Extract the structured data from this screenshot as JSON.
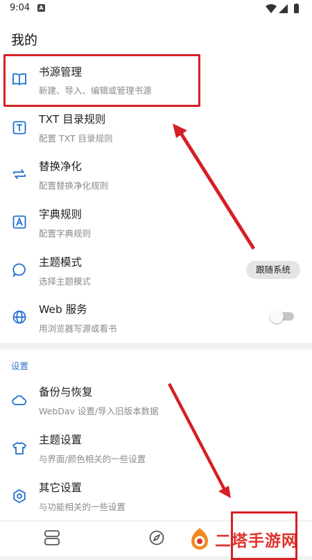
{
  "status_bar": {
    "time": "9:04",
    "notification": "A"
  },
  "page": {
    "title": "我的"
  },
  "items": [
    {
      "icon": "book-open-icon",
      "title": "书源管理",
      "subtitle": "新建、导入、编辑或管理书源"
    },
    {
      "icon": "txt-box-icon",
      "title": "TXT 目录规则",
      "subtitle": "配置 TXT 目录规则"
    },
    {
      "icon": "swap-arrows-icon",
      "title": "替换净化",
      "subtitle": "配置替换净化规则"
    },
    {
      "icon": "dictionary-box-icon",
      "title": "字典规则",
      "subtitle": "配置字典规则"
    },
    {
      "icon": "speech-bubble-icon",
      "title": "主题模式",
      "subtitle": "选择主题模式",
      "value": "跟随系统"
    },
    {
      "icon": "globe-icon",
      "title": "Web 服务",
      "subtitle": "用浏览器写源或看书",
      "toggle": false
    }
  ],
  "settings": {
    "header": "设置",
    "items": [
      {
        "icon": "cloud-icon",
        "title": "备份与恢复",
        "subtitle": "WebDav 设置/导入旧版本数据"
      },
      {
        "icon": "tshirt-icon",
        "title": "主题设置",
        "subtitle": "与界面/颜色相关的一些设置"
      },
      {
        "icon": "hexagon-settings-icon",
        "title": "其它设置",
        "subtitle": "与功能相关的一些设置"
      }
    ]
  },
  "bottom_nav": [
    "bookshelf-icon",
    "compass-icon",
    "rss-icon",
    "profile-icon"
  ],
  "watermark": {
    "text": "二塔手游网"
  },
  "colors": {
    "accent": "#2f74d0",
    "icon": "#1e6fd0",
    "annotation_red": "#d61f26",
    "watermark": "#e0312b"
  }
}
